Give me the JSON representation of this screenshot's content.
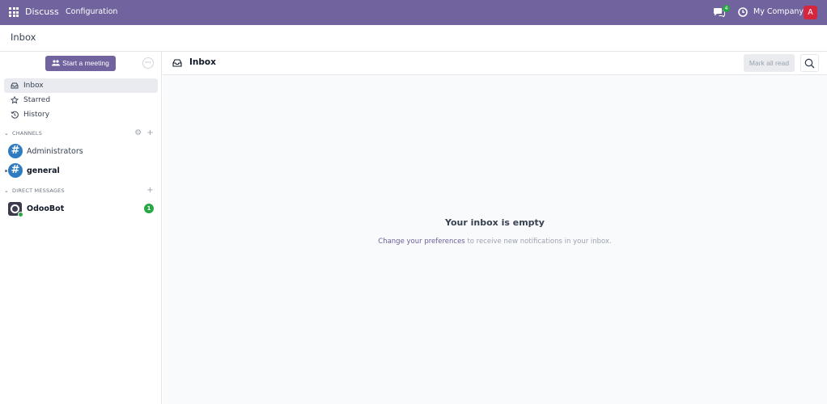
{
  "navbar": {
    "app_name": "Discuss",
    "menu_configuration": "Configuration",
    "chat_badge": "4",
    "company": "My Company",
    "avatar_letter": "A"
  },
  "control_panel": {
    "title": "Inbox"
  },
  "sidebar": {
    "start_meeting": "Start a meeting",
    "more_label": "···",
    "mailboxes": [
      {
        "label": "Inbox",
        "icon": "inbox-icon",
        "active": true
      },
      {
        "label": "Starred",
        "icon": "star-icon",
        "active": false
      },
      {
        "label": "History",
        "icon": "history-icon",
        "active": false
      }
    ],
    "channels_header": "CHANNELS",
    "channels": [
      {
        "label": "Administrators",
        "unread": false
      },
      {
        "label": "general",
        "unread": true
      }
    ],
    "dm_header": "DIRECT MESSAGES",
    "direct_messages": [
      {
        "label": "OdooBot",
        "badge": "1"
      }
    ]
  },
  "thread": {
    "title": "Inbox",
    "mark_all_read": "Mark all read",
    "empty_title": "Your inbox is empty",
    "empty_link": "Change your preferences",
    "empty_rest": " to receive new notifications in your inbox."
  },
  "colors": {
    "brand": "#71639e",
    "avatar": "#d5263e",
    "channel": "#2e7bbf",
    "success": "#28a745"
  }
}
